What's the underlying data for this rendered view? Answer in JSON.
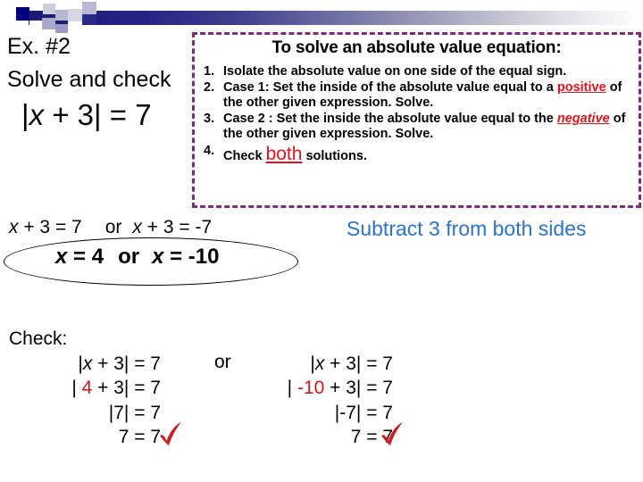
{
  "slide": {
    "example_title": "Ex. #2",
    "instruction_line": "Solve and check",
    "main_equation": {
      "prefix": "|",
      "variable": "x",
      "rest": " + 3| = 7"
    }
  },
  "steps_box": {
    "title": "To solve an absolute value equation:",
    "items": [
      {
        "number": "1.",
        "parts": [
          {
            "text": "Isolate the absolute value on one side of the equal sign.",
            "style": "plain"
          }
        ]
      },
      {
        "number": "2.",
        "parts": [
          {
            "text": "Case 1: Set the inside of the absolute value equal to a ",
            "style": "plain"
          },
          {
            "text": "positive",
            "style": "red-underline"
          },
          {
            "text": " of the other given expression.  Solve.",
            "style": "plain"
          }
        ]
      },
      {
        "number": "3.",
        "parts": [
          {
            "text": "Case 2 : Set the inside the absolute value equal to the ",
            "style": "plain"
          },
          {
            "text": "negative",
            "style": "red-underline-italic"
          },
          {
            "text": " of the other given expression.  Solve.",
            "style": "plain"
          }
        ]
      },
      {
        "number": "4.",
        "parts": [
          {
            "text": "Check ",
            "style": "plain"
          },
          {
            "text": "both",
            "style": "red-underline-large"
          },
          {
            "text": " solutions.",
            "style": "plain"
          }
        ]
      }
    ]
  },
  "work": {
    "case_line": {
      "left_var": "x",
      "left_rest": " + 3 = 7",
      "connector": "or",
      "right_var": "x",
      "right_rest": " + 3 = -7"
    },
    "answer_line": {
      "left_var": "x",
      "left_rest": " = 4",
      "connector": "or",
      "right_var": "x",
      "right_rest": " = -10"
    },
    "side_note": "Subtract 3 from both sides"
  },
  "check": {
    "label": "Check:",
    "connector": "or",
    "left_column": [
      {
        "pre": "|",
        "var": "x",
        "post": " + 3| = 7"
      },
      {
        "pre": "| ",
        "red": "4",
        "post": " + 3| = 7"
      },
      {
        "pre": "|7| = 7"
      },
      {
        "pre": "7 = 7"
      }
    ],
    "right_column": [
      {
        "pre": "|",
        "var": "x",
        "post": " + 3| = 7"
      },
      {
        "pre": "| ",
        "red": "-10",
        "post": " + 3| = 7"
      },
      {
        "pre": "|-7| = 7"
      },
      {
        "pre": "7 = 7"
      }
    ],
    "checkmark": "check-mark"
  },
  "colors": {
    "accent_purple": "#7d2a80",
    "highlight_red": "#e8131a",
    "note_blue": "#2a74c8",
    "banner_navy": "#000080",
    "check_red": "#cc1f22"
  }
}
